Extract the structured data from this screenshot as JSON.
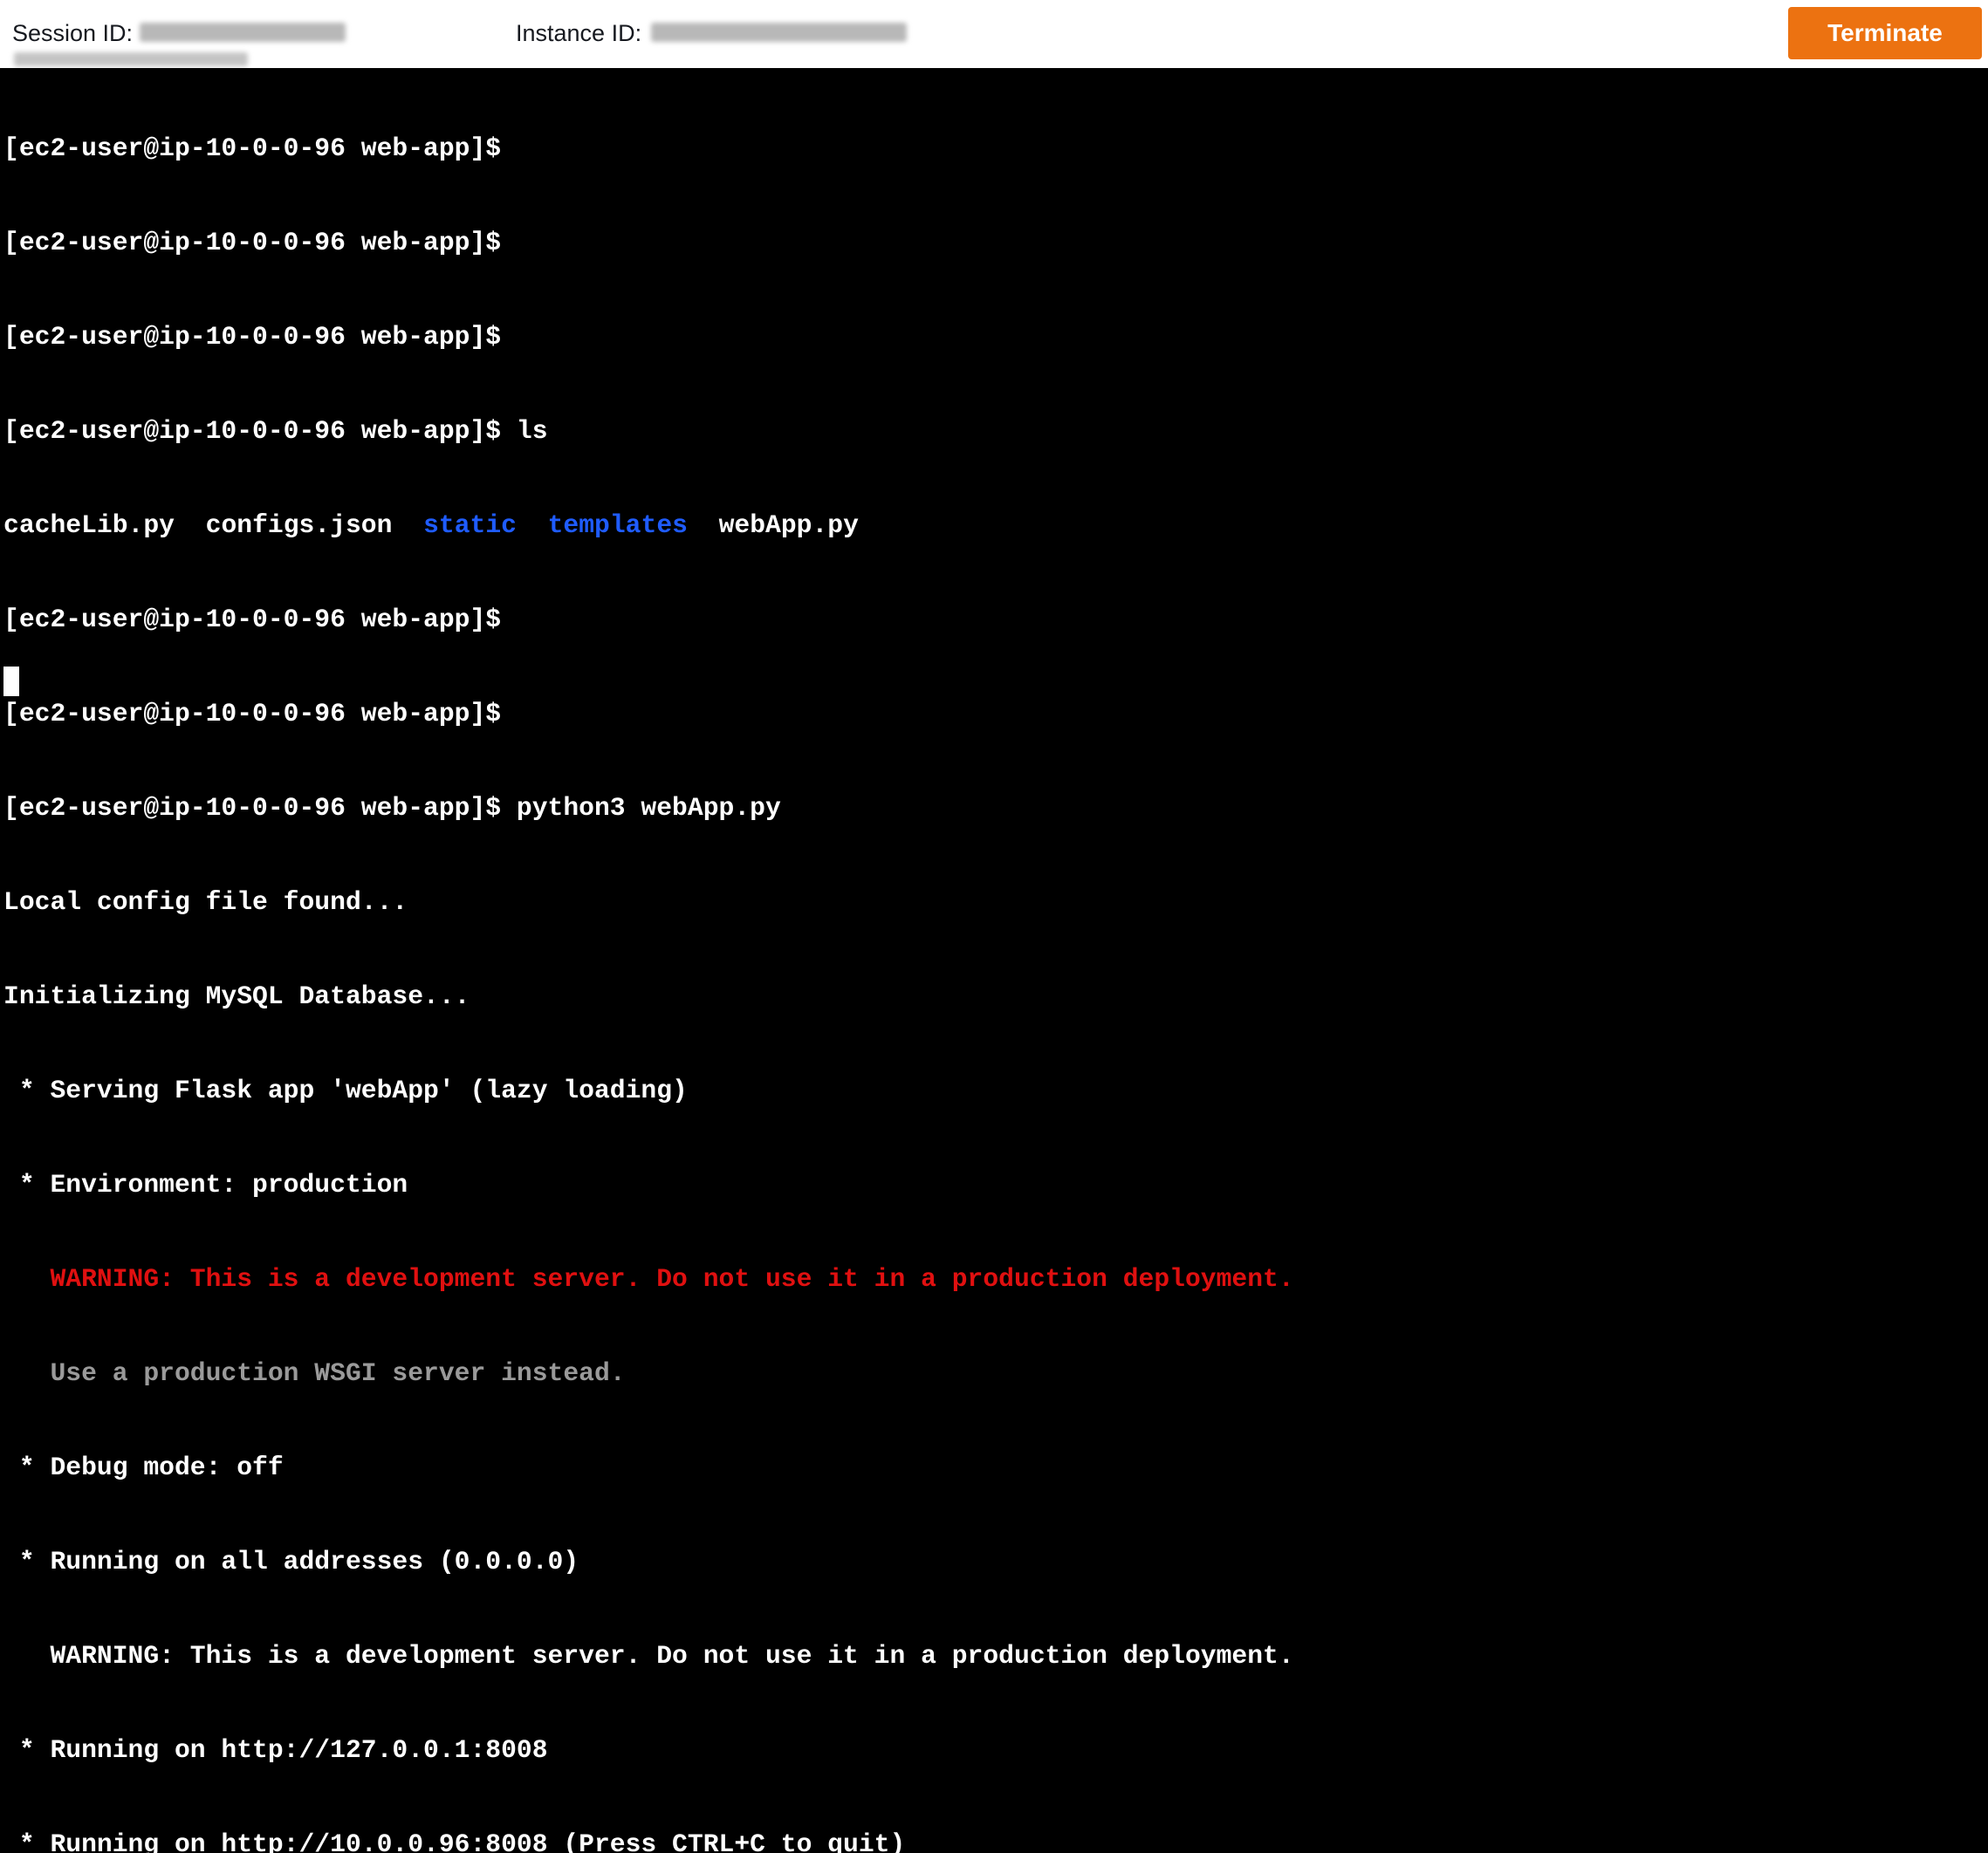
{
  "header": {
    "session_label": "Session ID:",
    "instance_label": "Instance ID:",
    "terminate_label": "Terminate"
  },
  "colors": {
    "accent": "#ec7211",
    "terminal_bg": "#000000",
    "warning": "#e01010",
    "directory": "#1f5cff"
  },
  "terminal": {
    "lines": [
      "[ec2-user@ip-10-0-0-96 web-app]$",
      "[ec2-user@ip-10-0-0-96 web-app]$",
      "[ec2-user@ip-10-0-0-96 web-app]$",
      "[ec2-user@ip-10-0-0-96 web-app]$ ls",
      "",
      "[ec2-user@ip-10-0-0-96 web-app]$",
      "[ec2-user@ip-10-0-0-96 web-app]$",
      "[ec2-user@ip-10-0-0-96 web-app]$ python3 webApp.py",
      "Local config file found...",
      "Initializing MySQL Database...",
      " * Serving Flask app 'webApp' (lazy loading)",
      " * Environment: production",
      "   WARNING: This is a development server. Do not use it in a production deployment.",
      "   Use a production WSGI server instead.",
      " * Debug mode: off",
      " * Running on all addresses (0.0.0.0)",
      "   WARNING: This is a development server. Do not use it in a production deployment.",
      " * Running on http://127.0.0.1:8008",
      " * Running on http://10.0.0.96:8008 (Press CTRL+C to quit)"
    ],
    "ls_output": {
      "file1": "cacheLib.py",
      "file2": "configs.json",
      "dir1": "static",
      "dir2": "templates",
      "file3": "webApp.py"
    }
  }
}
